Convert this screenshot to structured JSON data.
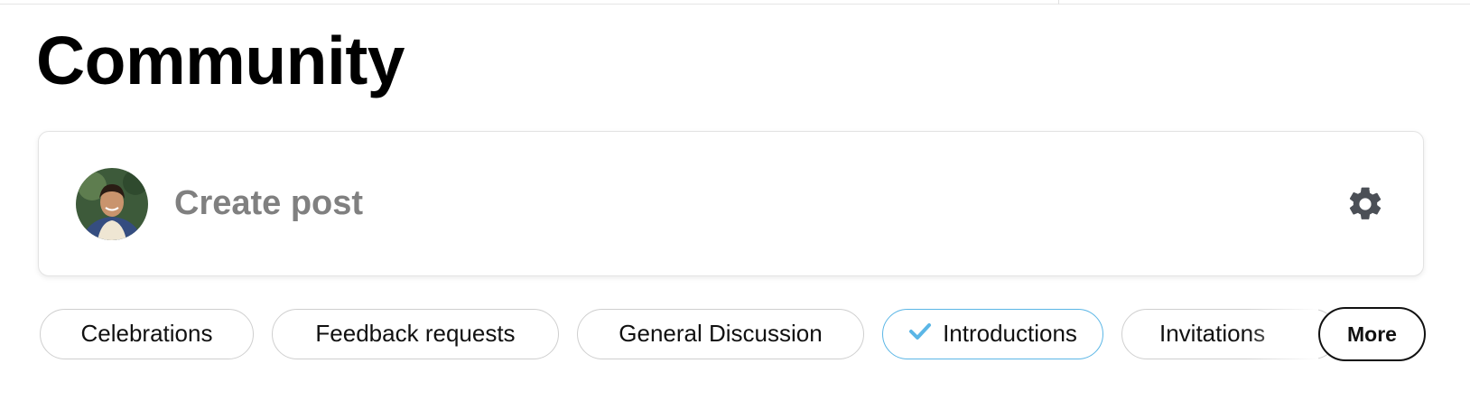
{
  "header": {
    "title": "Community"
  },
  "composer": {
    "placeholder": "Create post",
    "avatar_icon": "user-avatar-photo",
    "settings_icon": "gear-icon"
  },
  "topics": {
    "chips": [
      {
        "label": "Celebrations",
        "selected": false
      },
      {
        "label": "Feedback requests",
        "selected": false
      },
      {
        "label": "General Discussion",
        "selected": false
      },
      {
        "label": "Introductions",
        "selected": true
      },
      {
        "label": "Invitations",
        "selected": false
      }
    ],
    "more_label": "More",
    "selected_icon": "check-icon"
  },
  "colors": {
    "accent": "#5bb6e6",
    "muted_text": "#808080",
    "gear": "#4b4f56"
  }
}
